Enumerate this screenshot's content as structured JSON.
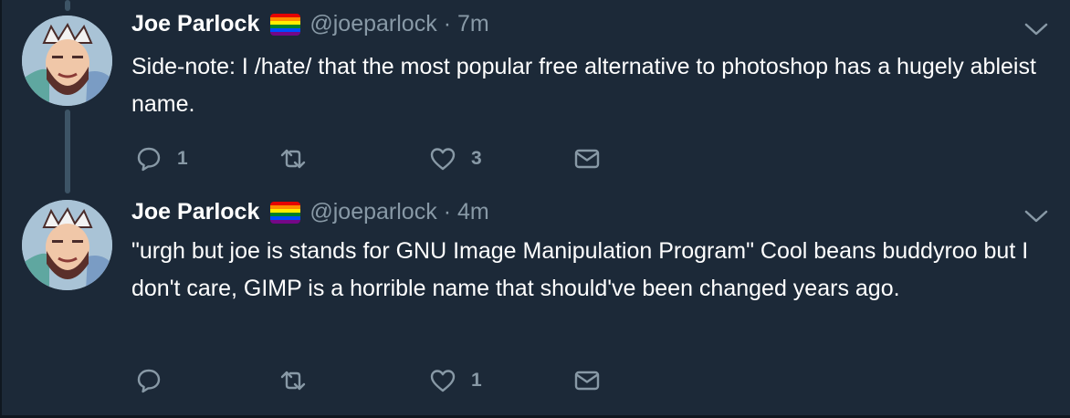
{
  "tweets": [
    {
      "author": {
        "name": "Joe Parlock",
        "handle": "@joeparlock",
        "badge_icon": "rainbow-flag-icon"
      },
      "separator": "·",
      "time": "7m",
      "text": "Side-note: I /hate/ that the most popular free alternative to photoshop has a hugely ableist name.",
      "actions": {
        "reply_count": "1",
        "retweet_count": "",
        "like_count": "3"
      }
    },
    {
      "author": {
        "name": "Joe Parlock",
        "handle": "@joeparlock",
        "badge_icon": "rainbow-flag-icon"
      },
      "separator": "·",
      "time": "4m",
      "text": "\"urgh but joe is stands for GNU Image Manipulation Program\" Cool beans buddyroo but I don't care, GIMP is a horrible name that should've been changed years ago.",
      "actions": {
        "reply_count": "",
        "retweet_count": "",
        "like_count": "1"
      }
    }
  ],
  "icons": [
    "reply-icon",
    "retweet-icon",
    "like-icon",
    "direct-message-icon",
    "chevron-down-icon"
  ],
  "colors": {
    "background": "#1c2938",
    "text": "#ffffff",
    "muted": "#8899a6",
    "thread_line": "#3d5466",
    "flag": [
      "#e40303",
      "#ff8c00",
      "#ffed00",
      "#008026",
      "#004dff",
      "#750787"
    ]
  }
}
